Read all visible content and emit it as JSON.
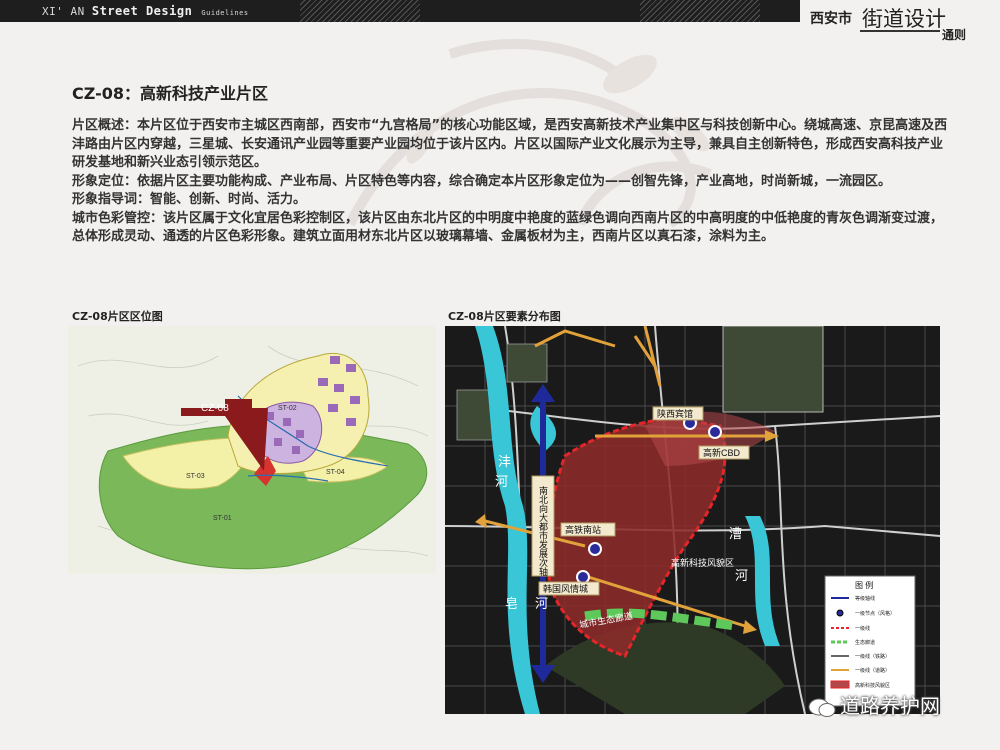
{
  "header": {
    "city_prefix": "XI' AN",
    "title_main": "Street Design",
    "title_sub": "Guidelines"
  },
  "brand": {
    "city": "西安市",
    "title": "街道设计",
    "subtitle": "通则"
  },
  "section": {
    "title": "CZ-08：高新科技产业片区",
    "paragraphs": [
      "片区概述：本片区位于西安市主城区西南部，西安市“九宫格局”的核心功能区域，是西安高新技术产业集中区与科技创新中心。绕城高速、京昆高速及西沣路由片区内穿越，三星城、长安通讯产业园等重要产业园均位于该片区内。片区以国际产业文化展示为主导，兼具自主创新特色，形成西安高科技产业研发基地和新兴业态引领示范区。",
      "形象定位：依据片区主要功能构成、产业布局、片区特色等内容，综合确定本片区形象定位为——创智先锋，产业高地，时尚新城，一流园区。",
      "形象指导词：智能、创新、时尚、活力。",
      "城市色彩管控：该片区属于文化宜居色彩控制区，该片区由东北片区的中明度中艳度的蓝绿色调向西南片区的中高明度的中低艳度的青灰色调渐变过渡，总体形成灵动、通透的片区色彩形象。建筑立面用材东北片区以玻璃幕墙、金属板材为主，西南片区以真石漆，涂料为主。"
    ]
  },
  "left_map": {
    "caption": "CZ-08片区区位图",
    "callout": "CZ-08",
    "zones": [
      "ST-01",
      "ST-02",
      "ST-03",
      "ST-04"
    ]
  },
  "right_map": {
    "caption": "CZ-08片区要素分布图",
    "labels": {
      "shaanxi_hotel": "陕西宾馆",
      "gaoxin_cbd": "高新CBD",
      "hsr_south": "高铁南站",
      "axis": "南北向大都市发展次轴",
      "scenic": "韩国风情城",
      "windzone": "高新科技风貌区",
      "ecology": "城市生态廊道",
      "river_1": "沣",
      "river_2": "河",
      "river_3": "皂",
      "river_4": "河",
      "river_5": "漕",
      "river_6": "河"
    },
    "legend": {
      "title": "图 例",
      "items": [
        "等级轴线",
        "一级节点（风格）",
        "一级线",
        "生态廊道",
        "一级线（铁路）",
        "一级线（道路）",
        "高新科技风貌区"
      ]
    }
  },
  "watermark": "道路养护网",
  "colors": {
    "topbar": "#1e1e1e",
    "map_dark": "#1a1a1a",
    "zone_red": "#b4474a",
    "axis_blue": "#1f2a9a",
    "river_cyan": "#39c6d6",
    "ecology_green": "#5ec95a",
    "arrow_gold": "#e2a23a",
    "district_yellow": "#f3f0a8",
    "outer_green": "#7ab85a"
  }
}
